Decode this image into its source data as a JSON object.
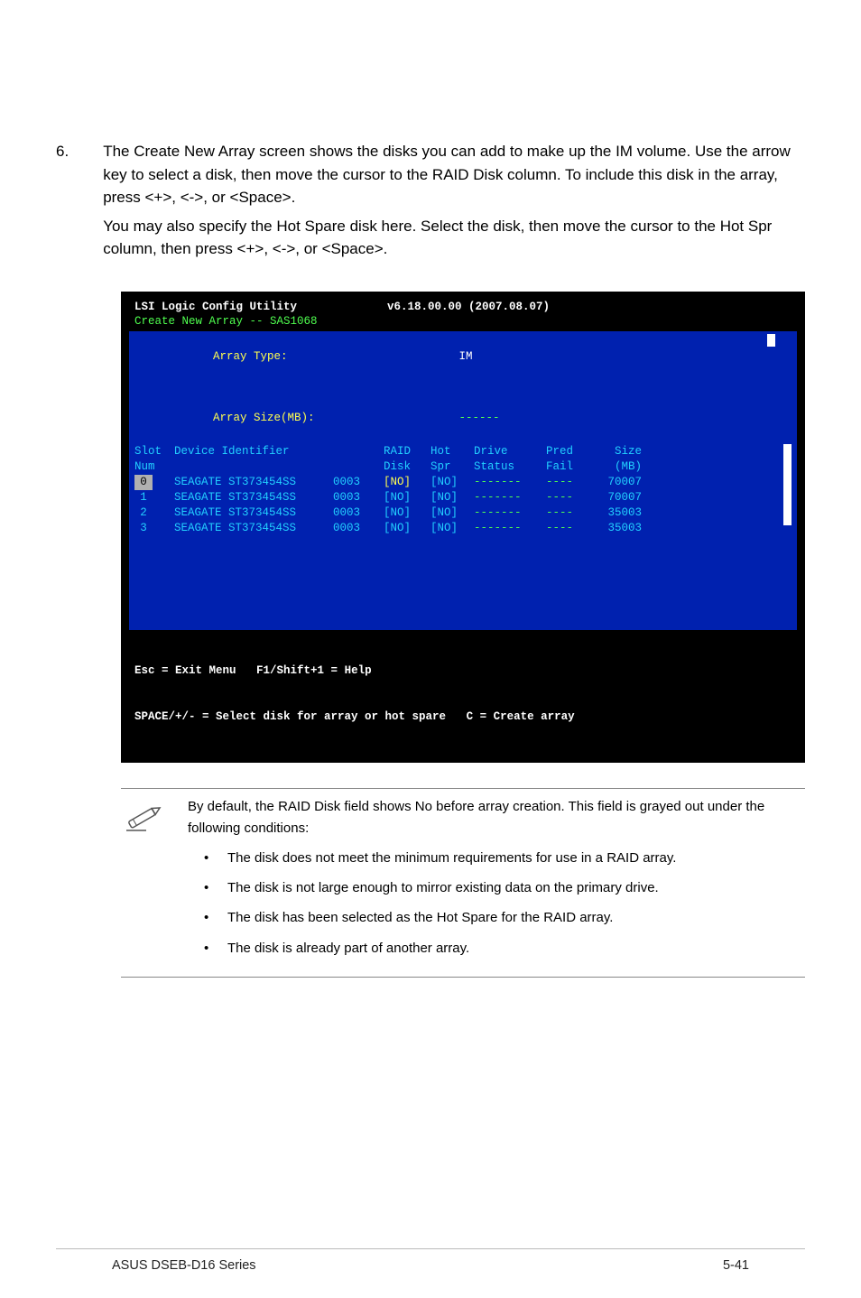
{
  "step": {
    "number": "6.",
    "para1": "The Create New Array screen shows the disks you can add to make up the IM volume. Use the arrow key to select a disk, then move the cursor to the RAID Disk column. To include this disk in the array, press <+>, <->, or <Space>.",
    "para2": "You may also specify the Hot Spare disk here. Select the disk, then move the cursor to the Hot Spr column, then press <+>, <->, or <Space>."
  },
  "terminal": {
    "title_left": "LSI Logic Config Utility",
    "title_right": "v6.18.00.00 (2007.08.07)",
    "subtitle": "Create New Array -- SAS1068",
    "array_type_label": "Array Type:",
    "array_type_value": "IM",
    "array_size_label": "Array Size(MB):",
    "array_size_value": "------",
    "headers_line1": {
      "c0": "Slot",
      "c1": "Device Identifier",
      "c2": "",
      "c3": "RAID",
      "c4": "Hot",
      "c5": "Drive",
      "c6": "Pred",
      "c7": "Size"
    },
    "headers_line2": {
      "c0": "Num",
      "c1": "",
      "c2": "",
      "c3": "Disk",
      "c4": "Spr",
      "c5": "Status",
      "c6": "Fail",
      "c7": "(MB)"
    },
    "rows": [
      {
        "num": "0",
        "dev": "SEAGATE ST373454SS",
        "code": "0003",
        "raid": "[NO]",
        "hot": "[NO]",
        "drive": "-------",
        "pred": "----",
        "size": "70007",
        "selected": true
      },
      {
        "num": "1",
        "dev": "SEAGATE ST373454SS",
        "code": "0003",
        "raid": "[NO]",
        "hot": "[NO]",
        "drive": "-------",
        "pred": "----",
        "size": "70007",
        "selected": false
      },
      {
        "num": "2",
        "dev": "SEAGATE ST373454SS",
        "code": "0003",
        "raid": "[NO]",
        "hot": "[NO]",
        "drive": "-------",
        "pred": "----",
        "size": "35003",
        "selected": false
      },
      {
        "num": "3",
        "dev": "SEAGATE ST373454SS",
        "code": "0003",
        "raid": "[NO]",
        "hot": "[NO]",
        "drive": "-------",
        "pred": "----",
        "size": "35003",
        "selected": false
      }
    ],
    "footer_line1_left": "Esc = Exit Menu",
    "footer_line1_right": "F1/Shift+1 = Help",
    "footer_line2_left": "SPACE/+/- = Select disk for array or hot spare",
    "footer_line2_right": "C = Create array"
  },
  "note": {
    "intro": "By default, the RAID Disk field shows No before array creation. This field is grayed out under the following conditions:",
    "bullets": [
      "The disk does not meet the  minimum requirements for use in a RAID array.",
      "The disk is not large enough to mirror existing data on the primary drive.",
      "The disk has been selected as the Hot Spare for the RAID array.",
      "The disk is already part of another array."
    ]
  },
  "footer": {
    "left": "ASUS DSEB-D16 Series",
    "right": "5-41"
  }
}
